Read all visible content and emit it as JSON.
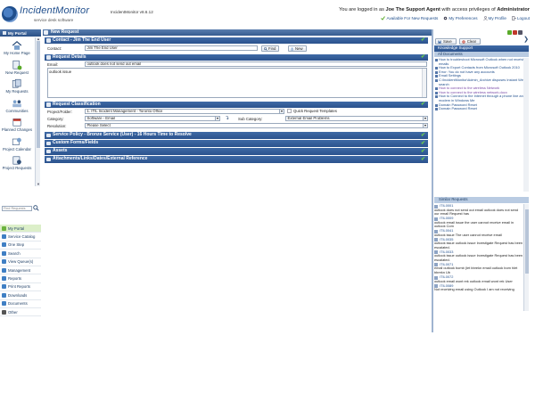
{
  "header": {
    "logo_name": "IncidentMonitor",
    "logo_tag": "service desk software",
    "app_version": "IncidentMonitor v8.6.12",
    "login_prefix": "You are logged in as",
    "login_user": "Joe The Support Agent",
    "login_middle": "with access privileges of",
    "login_role": "Administrator",
    "links": [
      {
        "label": "Available For New Requests",
        "icon": "check-icon"
      },
      {
        "label": "My Preferences",
        "icon": "gear-icon"
      },
      {
        "label": "My Profile",
        "icon": "user-icon"
      },
      {
        "label": "Logout",
        "icon": "logout-icon"
      }
    ]
  },
  "sidebar": {
    "title": "My Portal",
    "icons": [
      {
        "label": "My Home Page",
        "icon": "home-icon"
      },
      {
        "label": "New Request",
        "icon": "new-request-icon"
      },
      {
        "label": "My Requests",
        "icon": "my-requests-icon"
      },
      {
        "label": "Communities",
        "icon": "communities-icon"
      },
      {
        "label": "Planned Changes",
        "icon": "calendar-icon"
      },
      {
        "label": "Project Calendar",
        "icon": "project-calendar-icon"
      },
      {
        "label": "Project Requests",
        "icon": "project-requests-icon"
      }
    ],
    "search_placeholder": "Find Requests",
    "list": [
      {
        "label": "My Portal",
        "color": "#6cb33f"
      },
      {
        "label": "Service Catalog",
        "color": "#3f7fc4"
      },
      {
        "label": "One Step",
        "color": "#3f7fc4"
      },
      {
        "label": "Search",
        "color": "#3f7fc4"
      },
      {
        "label": "View Queue(s)",
        "color": "#3f7fc4"
      },
      {
        "label": "Management",
        "color": "#3f7fc4"
      },
      {
        "label": "Reports",
        "color": "#3f7fc4"
      },
      {
        "label": "Print Reports",
        "color": "#3f7fc4"
      },
      {
        "label": "Downloads",
        "color": "#3f7fc4"
      },
      {
        "label": "Documents",
        "color": "#3f7fc4"
      },
      {
        "label": "Other",
        "color": "#555555"
      }
    ]
  },
  "main": {
    "title": "New Request",
    "contact": {
      "bar": "Contact - Jim The End User",
      "label": "Contact:",
      "value": "Jim The End User",
      "find_label": "Find",
      "new_label": "New"
    },
    "details": {
      "bar": "Request Details",
      "email_label": "Email:",
      "email_value": "outlook does not send out email",
      "body": "outlook issue"
    },
    "classification": {
      "bar": "Request Classification",
      "project_label": "Project/Folder:",
      "project_value": "1. ITIL Incident Management - Toronto Office",
      "templates_label": "Quick Request Templates",
      "category_label": "Category:",
      "category_value": "Software - Email",
      "subcategory_label": "Sub Category:",
      "subcategory_value": "External Email Problems",
      "resolution_label": "Resolution:",
      "resolution_value": "Please Select"
    },
    "sections": [
      "Service Policy - Bronze Service (User) - 16 Hours Time to Resolve",
      "Custom Forms/Fields",
      "Assets",
      "Attachments/Links/Dates/External Reference"
    ]
  },
  "right": {
    "save_label": "Save",
    "clear_label": "Clear",
    "kb_title": "Knowledge Support",
    "kb_all": "All Documents",
    "kb_items": [
      "How to troubleshoot Microsoft Outlook when not receiving emails",
      "How to Export Contacts from Microsoft Outlook 2010",
      "Error: You do not have any accounts",
      "Email Settings",
      "C:\\IncidentMonitor\\Admin_Archive disposes Instant Web search",
      "How to connect to the wireless Network",
      "How to connect to the wireless network.docx",
      "How to Connect to the Internet through a phone line and modem in Windows Me",
      "Domain Password Reset",
      "Domain Password Reset"
    ],
    "similar_title": "Similar Requests",
    "similar": [
      {
        "id": "ITIL0001",
        "text": "outlook does not send out email outlook does not send our email Request has"
      },
      {
        "id": "ITIL0009",
        "text": "outlook email issue the user cannot receive email in outlook Com"
      },
      {
        "id": "ITIL0041",
        "text": "outlook issue The user cannot receive email"
      },
      {
        "id": "ITIL0035",
        "text": "outlook issue outlook issue Investigate Request has been escalated."
      },
      {
        "id": "ITIL0033",
        "text": "outlook issue outlook issue Investigate Request has been escalated."
      },
      {
        "id": "ITIL0071",
        "text": "email outlook bomb (let bbrekn email outlook bom hlet bbrekn Ub"
      },
      {
        "id": "ITIL0072",
        "text": "outlook email wont rek outlook email wont rek User"
      },
      {
        "id": "ITIL0089",
        "text": "Not receiving email using Outlook I am not receiving"
      }
    ]
  }
}
